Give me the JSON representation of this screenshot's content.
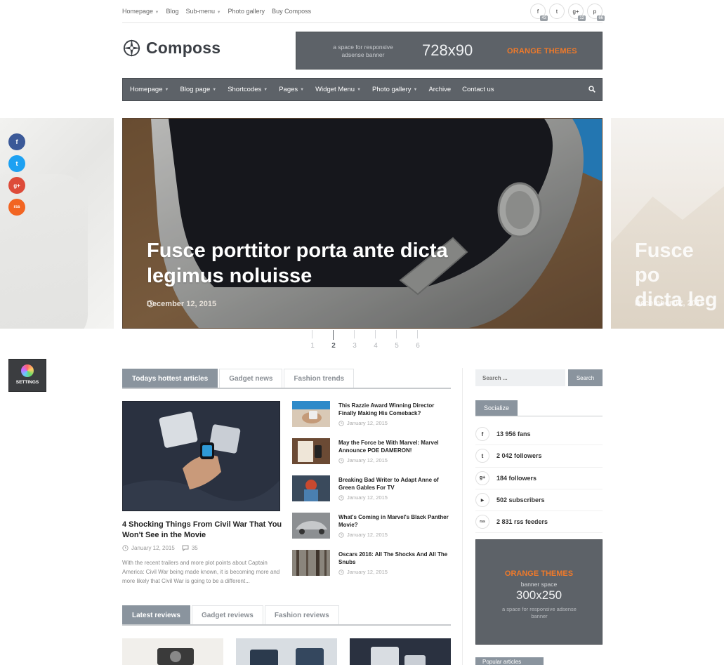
{
  "topbar": {
    "nav": [
      "Homepage",
      "Blog",
      "Sub-menu",
      "Photo gallery",
      "Buy Composs"
    ],
    "has_caret": [
      true,
      false,
      true,
      false,
      false
    ],
    "social": [
      {
        "icon": "facebook-icon",
        "glyph": "f",
        "count": "43"
      },
      {
        "icon": "twitter-icon",
        "glyph": "t",
        "count": ""
      },
      {
        "icon": "google-plus-icon",
        "glyph": "g+",
        "count": "12"
      },
      {
        "icon": "pinterest-icon",
        "glyph": "p",
        "count": "66"
      }
    ]
  },
  "logo": {
    "name": "Composs"
  },
  "ad_banner": {
    "small": "a space for responsive adsense banner",
    "size": "728x90",
    "brand": "ORANGE THEMES"
  },
  "main_nav": {
    "items": [
      {
        "label": "Homepage",
        "caret": true
      },
      {
        "label": "Blog page",
        "caret": true
      },
      {
        "label": "Shortcodes",
        "caret": true
      },
      {
        "label": "Pages",
        "caret": true
      },
      {
        "label": "Widget Menu",
        "caret": true
      },
      {
        "label": "Photo gallery",
        "caret": true
      },
      {
        "label": "Archive",
        "caret": false
      },
      {
        "label": "Contact us",
        "caret": false
      }
    ]
  },
  "slider": {
    "title": "Fusce porttitor porta ante dicta legimus noluisse",
    "date": "December 12, 2015",
    "next_title": "Fusce po dicta leg",
    "next_date": "December 12, 2015",
    "pages": [
      "1",
      "2",
      "3",
      "4",
      "5",
      "6"
    ],
    "active_page": "2"
  },
  "float_social": [
    {
      "icon": "facebook-icon",
      "glyph": "f",
      "color": "#3b5998"
    },
    {
      "icon": "twitter-icon",
      "glyph": "t",
      "color": "#1da1f2"
    },
    {
      "icon": "google-plus-icon",
      "glyph": "g+",
      "color": "#dd4b39"
    },
    {
      "icon": "rss-icon",
      "glyph": "rss",
      "color": "#f26522"
    }
  ],
  "settings": {
    "label": "SETTINGS"
  },
  "tabs_top": [
    "Todays hottest articles",
    "Gadget news",
    "Fashion trends"
  ],
  "featured": {
    "title": "4 Shocking Things From Civil War That You Won't See in the Movie",
    "date": "January 12, 2015",
    "comments": "35",
    "excerpt": "With the recent trailers and more plot points about Captain America: Civil War being made known, it is becoming more and more likely that Civil War is going to be a different..."
  },
  "small_articles": [
    {
      "title": "This Razzie Award Winning Director Finally Making His Comeback?",
      "date": "January 12, 2015"
    },
    {
      "title": "May the Force be With Marvel: Marvel Announce POE DAMERON!",
      "date": "January 12, 2015"
    },
    {
      "title": "Breaking Bad Writer to Adapt Anne of Green Gables For TV",
      "date": "January 12, 2015"
    },
    {
      "title": "What's Coming in Marvel's Black Panther Movie?",
      "date": "January 12, 2015"
    },
    {
      "title": "Oscars 2016: All The Shocks And All The Snubs",
      "date": "January 12, 2015"
    }
  ],
  "tabs_bottom": [
    "Latest reviews",
    "Gadget reviews",
    "Fashion reviews"
  ],
  "sidebar": {
    "search_placeholder": "Search ...",
    "search_button": "Search",
    "socialize_title": "Socialize",
    "socialize": [
      {
        "icon": "facebook-icon",
        "glyph": "f",
        "text": "13 956 fans"
      },
      {
        "icon": "twitter-icon",
        "glyph": "t",
        "text": "2 042 followers"
      },
      {
        "icon": "google-plus-icon",
        "glyph": "g+",
        "text": "184 followers"
      },
      {
        "icon": "youtube-icon",
        "glyph": "▶",
        "text": "502 subscribers"
      },
      {
        "icon": "rss-icon",
        "glyph": "rss",
        "text": "2 831 rss feeders"
      }
    ],
    "ad": {
      "brand": "ORANGE THEMES",
      "label": "banner space",
      "size": "300x250",
      "small": "a space for responsive adsense banner"
    },
    "popular_title": "Popular articles"
  }
}
